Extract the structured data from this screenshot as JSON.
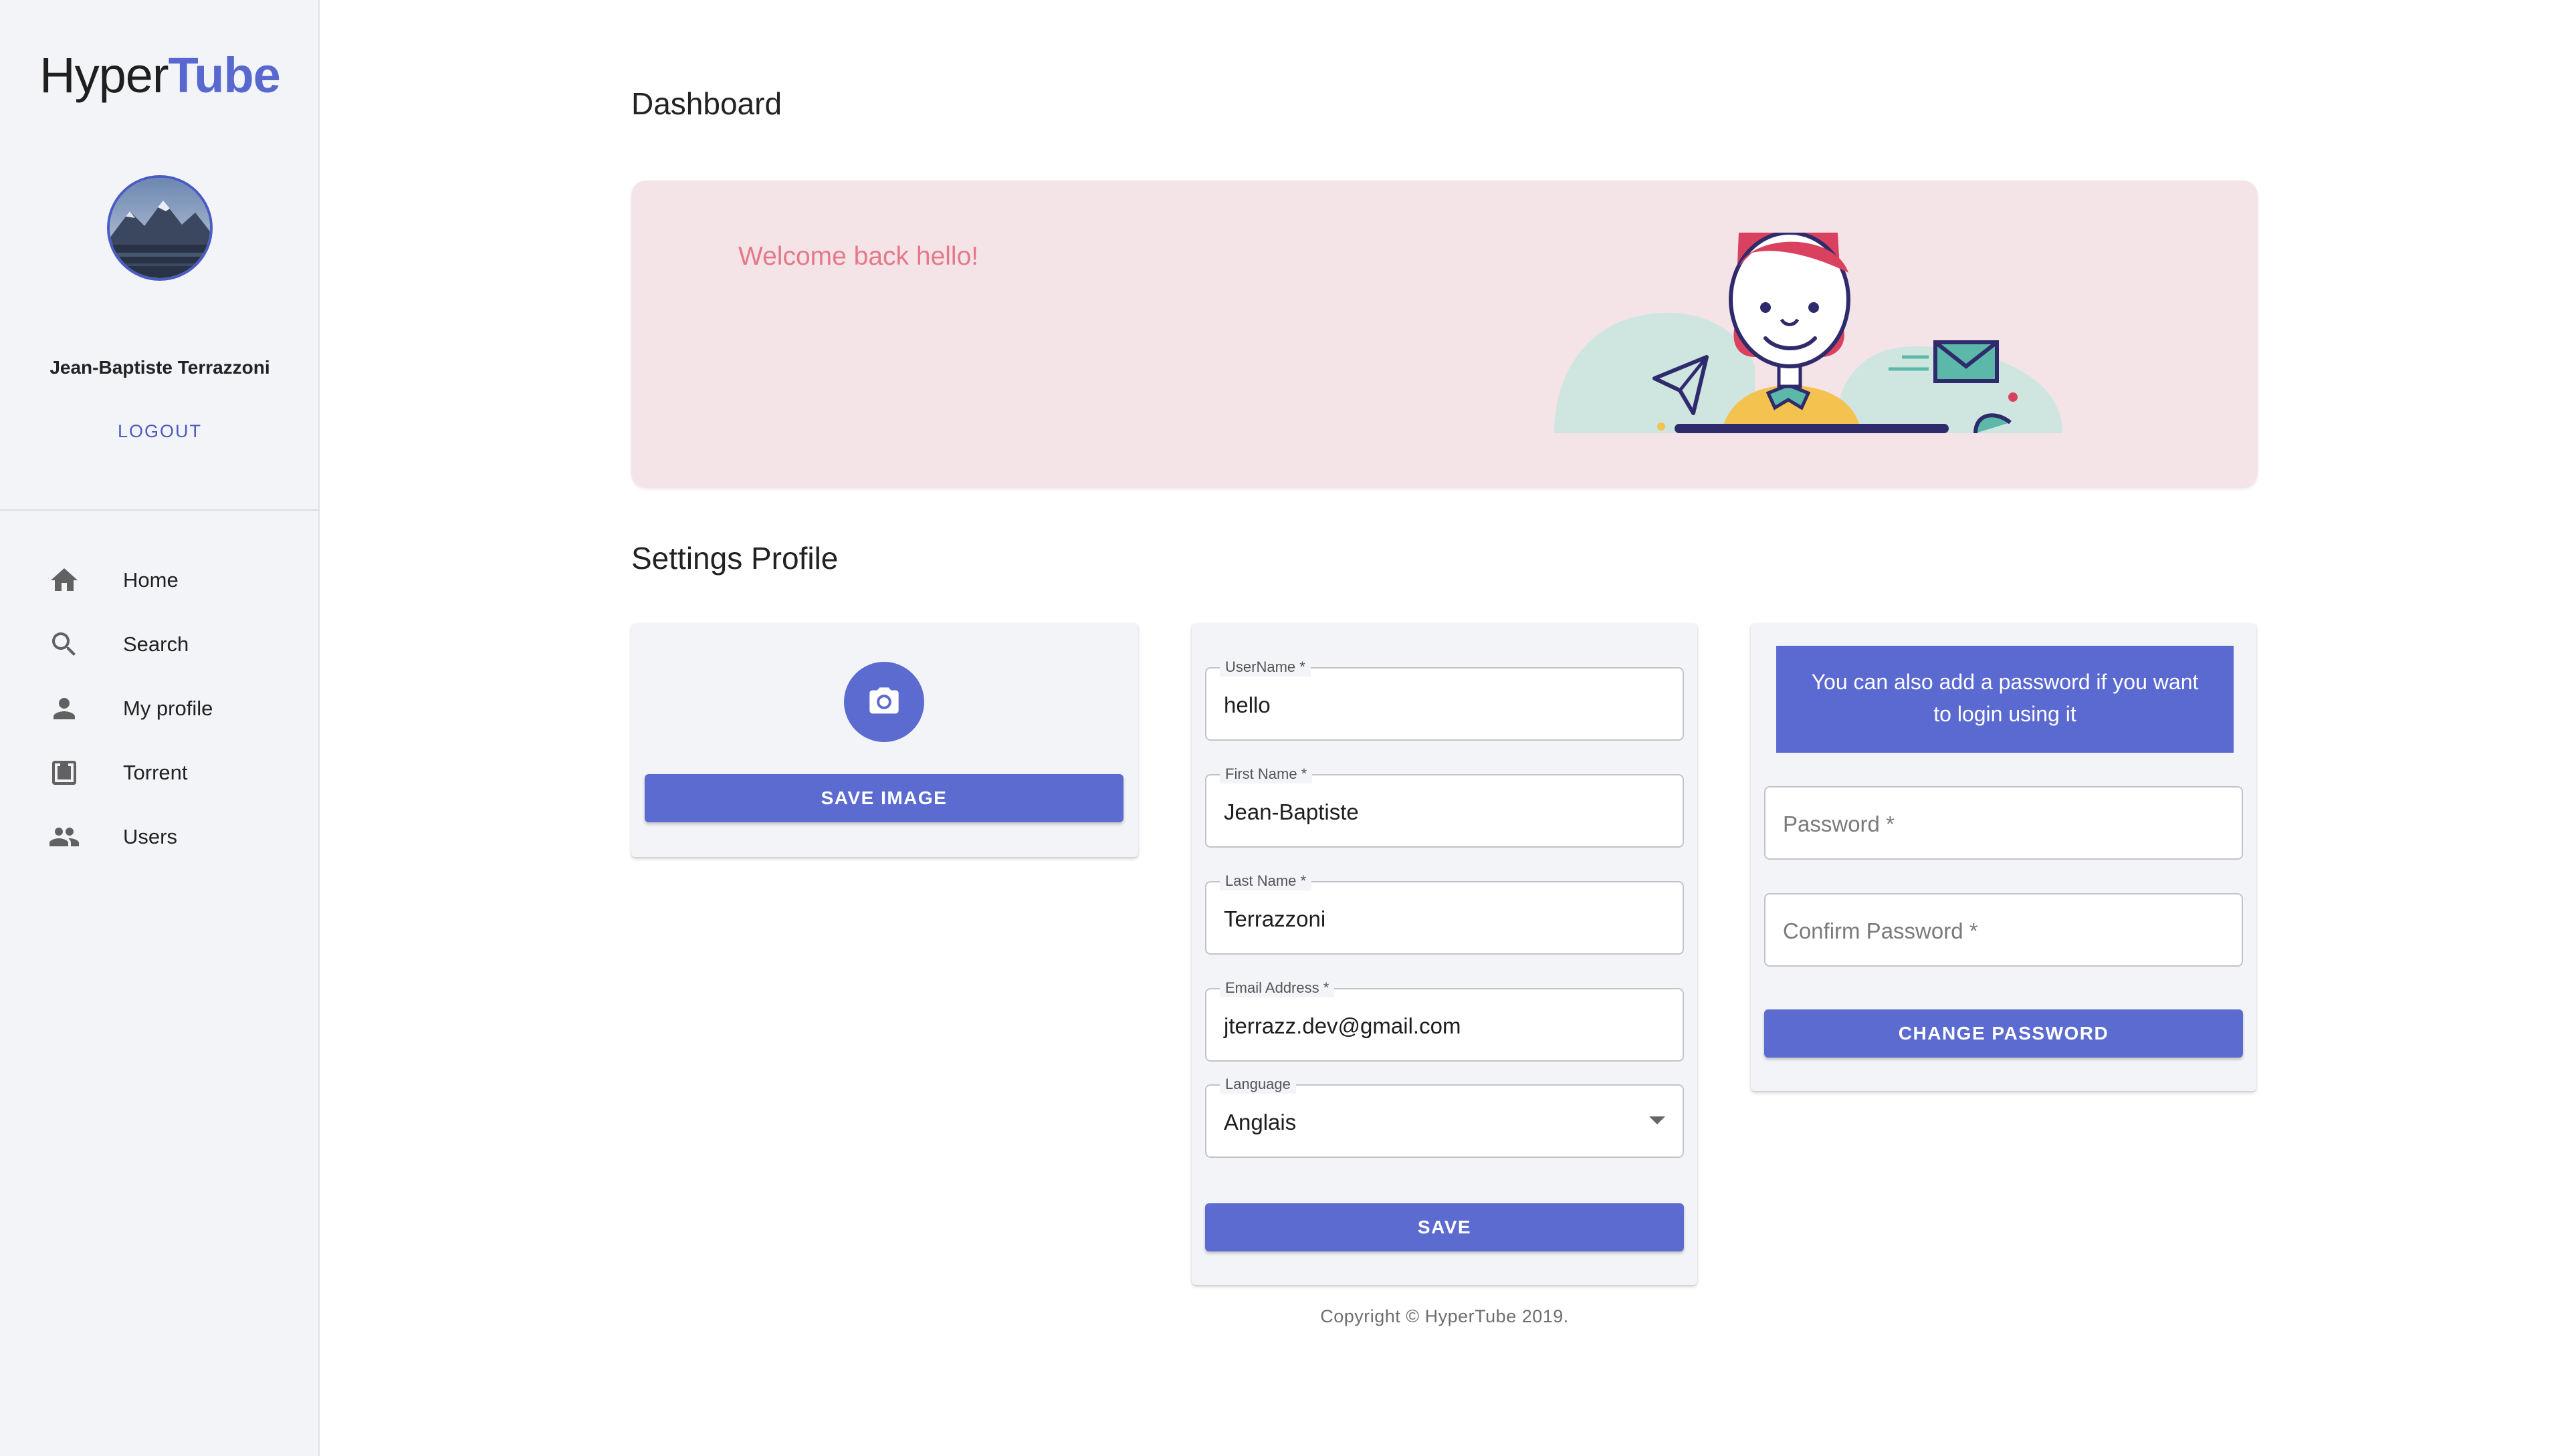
{
  "brand": {
    "prefix": "Hyper",
    "accent": "Tube"
  },
  "sidebar": {
    "user_name": "Jean-Baptiste Terrazzoni",
    "logout_label": "LOGOUT",
    "nav": [
      {
        "label": "Home",
        "icon": "home-icon"
      },
      {
        "label": "Search",
        "icon": "search-icon"
      },
      {
        "label": "My profile",
        "icon": "person-icon"
      },
      {
        "label": "Torrent",
        "icon": "download-icon"
      },
      {
        "label": "Users",
        "icon": "people-icon"
      }
    ]
  },
  "main": {
    "title": "Dashboard",
    "welcome": "Welcome back hello!",
    "settings_title": "Settings Profile"
  },
  "image_card": {
    "save_label": "SAVE IMAGE",
    "camera_icon": "camera-icon"
  },
  "profile_form": {
    "username": {
      "label": "UserName *",
      "value": "hello"
    },
    "first_name": {
      "label": "First Name *",
      "value": "Jean-Baptiste"
    },
    "last_name": {
      "label": "Last Name *",
      "value": "Terrazzoni"
    },
    "email": {
      "label": "Email Address *",
      "value": "jterrazz.dev@gmail.com"
    },
    "language": {
      "label": "Language",
      "value": "Anglais"
    },
    "save_label": "SAVE"
  },
  "password_card": {
    "info": "You can also add a password if you want to login using it",
    "password_placeholder": "Password *",
    "confirm_placeholder": "Confirm Password *",
    "change_label": "CHANGE PASSWORD"
  },
  "footer": {
    "copyright": "Copyright © HyperTube 2019."
  },
  "colors": {
    "accent": "#5b6bd0",
    "sidebar_bg": "#f3f4f8",
    "welcome_bg": "#f5e4e7",
    "welcome_text": "#e4788a"
  }
}
